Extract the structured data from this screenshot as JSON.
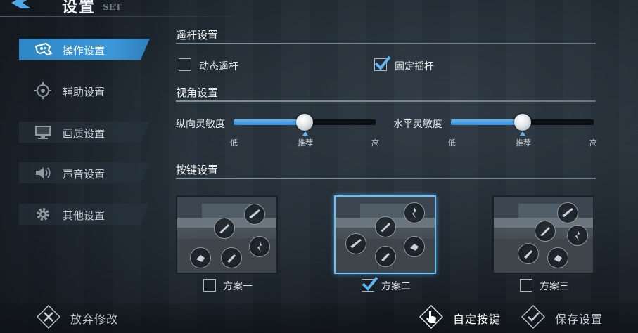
{
  "header": {
    "title": "设置",
    "subtitle": "SET"
  },
  "sidebar": {
    "items": [
      {
        "label": "操作设置",
        "icon": "gamepad-icon",
        "active": true
      },
      {
        "label": "辅助设置",
        "icon": "crosshair-icon",
        "active": false
      },
      {
        "label": "画质设置",
        "icon": "monitor-icon",
        "active": false
      },
      {
        "label": "声音设置",
        "icon": "speaker-icon",
        "active": false
      },
      {
        "label": "其他设置",
        "icon": "gear-icon",
        "active": false
      }
    ]
  },
  "joystick": {
    "title": "遥杆设置",
    "options": [
      {
        "label": "动态遥杆",
        "checked": false
      },
      {
        "label": "固定摇杆",
        "checked": true
      }
    ]
  },
  "view": {
    "title": "视角设置",
    "sliders": [
      {
        "label": "纵向灵敏度",
        "value": 0.5,
        "low": "低",
        "mid": "推荐",
        "high": "高"
      },
      {
        "label": "水平灵敏度",
        "value": 0.5,
        "low": "低",
        "mid": "推荐",
        "high": "高"
      }
    ]
  },
  "keys": {
    "title": "按键设置",
    "schemes": [
      {
        "label": "方案一",
        "checked": false
      },
      {
        "label": "方案二",
        "checked": true
      },
      {
        "label": "方案三",
        "checked": false
      }
    ]
  },
  "footer": {
    "discard": "放弃修改",
    "custom": "自定按键",
    "save": "保存设置"
  },
  "colors": {
    "accent": "#3d98d8",
    "check": "#5fb4f2"
  }
}
